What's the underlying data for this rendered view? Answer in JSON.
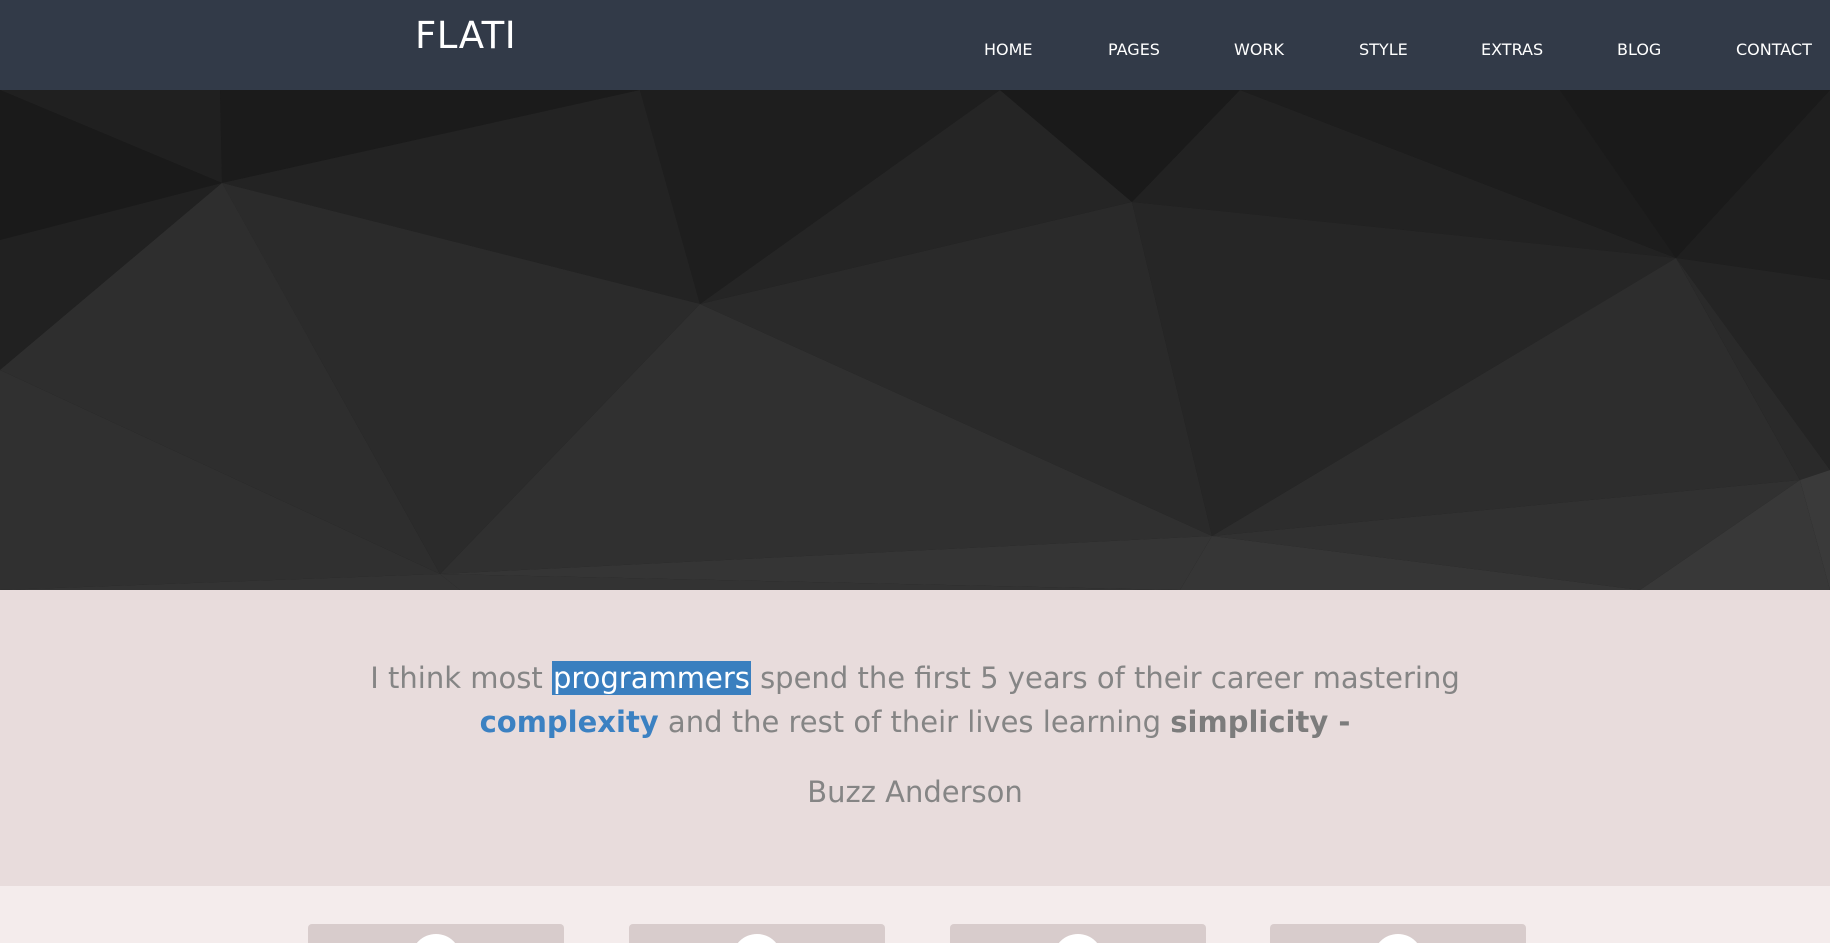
{
  "brand": {
    "logo": "FLATI"
  },
  "nav": {
    "items": [
      {
        "label": "HOME"
      },
      {
        "label": "PAGES"
      },
      {
        "label": "WORK"
      },
      {
        "label": "STYLE"
      },
      {
        "label": "EXTRAS"
      },
      {
        "label": "BLOG"
      },
      {
        "label": "CONTACT"
      }
    ]
  },
  "quote": {
    "part1": "I think most ",
    "highlight": "programmers",
    "part2": " spend the first 5 years of their career mastering",
    "accent": "complexity",
    "part3": " and the rest of their lives learning ",
    "strong": "simplicity -",
    "author": "Buzz Anderson"
  },
  "colors": {
    "navbar": "#323a48",
    "hero": "#1d1d1d",
    "quote_bg": "#e8dcdc",
    "accent": "#3b81c2",
    "cards_bg": "#f4ecec",
    "card": "#d8cccc"
  },
  "cards": [
    {
      "icon": "circle-icon"
    },
    {
      "icon": "circle-icon"
    },
    {
      "icon": "circle-icon"
    },
    {
      "icon": "circle-icon"
    }
  ]
}
